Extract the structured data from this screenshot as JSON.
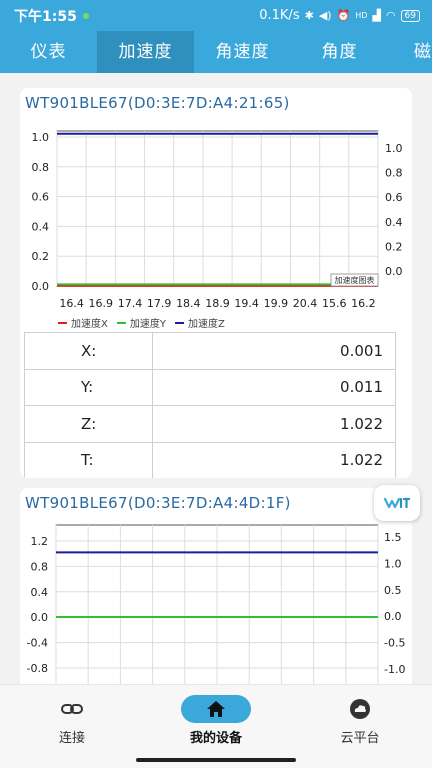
{
  "status_bar": {
    "time": "下午1:55",
    "net_speed": "0.1K/s",
    "hd_label": "HD",
    "battery": "69"
  },
  "tabs": [
    {
      "label": "仪表",
      "active": false
    },
    {
      "label": "加速度",
      "active": true
    },
    {
      "label": "角速度",
      "active": false
    },
    {
      "label": "角度",
      "active": false
    },
    {
      "label": "磁",
      "active": false
    }
  ],
  "device1": {
    "title": "WT901BLE67(D0:3E:7D:A4:21:65)",
    "chart_label": "加速度图表",
    "legend": [
      "加速度X",
      "加速度Y",
      "加速度Z"
    ],
    "readings": [
      {
        "key": "X:",
        "value": "0.001"
      },
      {
        "key": "Y:",
        "value": "0.011"
      },
      {
        "key": "Z:",
        "value": "1.022"
      },
      {
        "key": "T:",
        "value": "1.022"
      }
    ]
  },
  "device2": {
    "title": "WT901BLE67(D0:3E:7D:A4:4D:1F)"
  },
  "bottom_nav": [
    {
      "label": "连接",
      "icon": "link-icon",
      "active": false
    },
    {
      "label": "我的设备",
      "icon": "home-icon",
      "active": true
    },
    {
      "label": "云平台",
      "icon": "cloud-icon",
      "active": false
    }
  ],
  "chart_data": [
    {
      "type": "line",
      "x": [
        16.4,
        16.9,
        17.4,
        17.9,
        18.4,
        18.9,
        19.4,
        19.9,
        20.4,
        15.6,
        16.2
      ],
      "xticks": [
        "16.4",
        "16.9",
        "17.4",
        "17.9",
        "18.4",
        "18.9",
        "19.4",
        "19.9",
        "20.4",
        "15.6",
        "16.2"
      ],
      "ylim_left": [
        0.0,
        1.0
      ],
      "yticks_left": [
        "1.0",
        "0.8",
        "0.6",
        "0.4",
        "0.2",
        "0.0"
      ],
      "yticks_right": [
        "1.0",
        "0.8",
        "0.6",
        "0.4",
        "0.2",
        "0.0"
      ],
      "series": [
        {
          "name": "加速度X",
          "color": "#e02020",
          "values": [
            0.001,
            0.001,
            0.001,
            0.001,
            0.001,
            0.001,
            0.001,
            0.001,
            0.001,
            0.001,
            0.001
          ]
        },
        {
          "name": "加速度Y",
          "color": "#2fc12f",
          "values": [
            0.011,
            0.011,
            0.011,
            0.011,
            0.011,
            0.011,
            0.011,
            0.011,
            0.011,
            0.011,
            0.011
          ]
        },
        {
          "name": "加速度Z",
          "color": "#1a1aa8",
          "values": [
            1.022,
            1.022,
            1.022,
            1.022,
            1.022,
            1.022,
            1.022,
            1.022,
            1.022,
            1.022,
            1.022
          ]
        }
      ],
      "grid": true,
      "legend": "bottom-left"
    },
    {
      "type": "line",
      "yticks_left": [
        "1.2",
        "0.8",
        "0.4",
        "0.0",
        "-0.4",
        "-0.8"
      ],
      "yticks_right": [
        "1.5",
        "1.0",
        "0.5",
        "0.0",
        "-0.5",
        "-1.0"
      ],
      "series": [
        {
          "color": "#e02020",
          "values": [
            0.0,
            0.0,
            0.0,
            0.0,
            0.0,
            0.0,
            0.0,
            0.0,
            0.0,
            0.0,
            0.0
          ]
        },
        {
          "color": "#2fc12f",
          "values": [
            0.0,
            0.0,
            0.0,
            0.0,
            0.0,
            0.0,
            0.0,
            0.0,
            0.0,
            0.0,
            0.0
          ]
        },
        {
          "color": "#1a1aa8",
          "values": [
            1.02,
            1.02,
            1.02,
            1.02,
            1.02,
            1.02,
            1.02,
            1.02,
            1.02,
            1.02,
            1.02
          ]
        }
      ],
      "grid": true
    }
  ]
}
